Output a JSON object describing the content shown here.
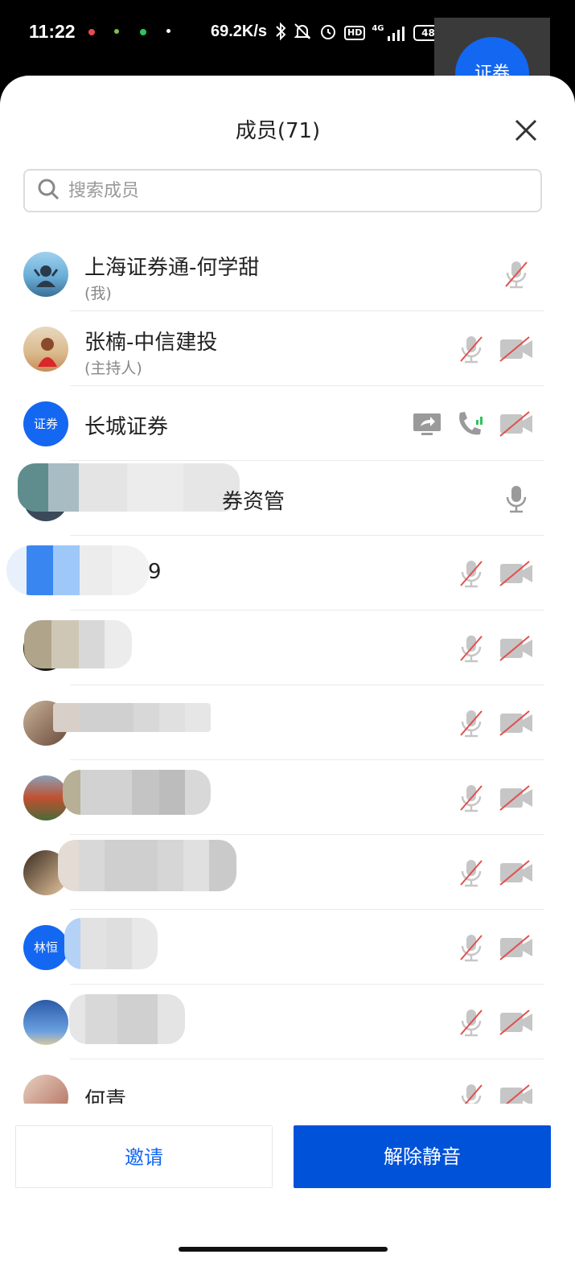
{
  "status_bar": {
    "time": "11:22",
    "speed": "69.2K/s",
    "hd": "HD",
    "network": "4G",
    "battery": "48"
  },
  "floating_button": {
    "label": "证券"
  },
  "panel": {
    "title": "成员(71)",
    "search_placeholder": "搜索成员"
  },
  "members": [
    {
      "name": "上海证券通-何学甜",
      "role": "(我)",
      "avatar_icon": "photo-avatar-icon"
    },
    {
      "name": "张楠-中信建投",
      "role": "(主持人)",
      "avatar_icon": "photo-avatar-icon"
    },
    {
      "name": "长城证券",
      "avatar_text": "证券"
    },
    {
      "name_visible": "券资管"
    },
    {
      "name_visible": "9"
    },
    {
      "name_visible": ""
    },
    {
      "name_visible": ""
    },
    {
      "name_visible": ""
    },
    {
      "name_visible": ""
    },
    {
      "name_visible": "",
      "avatar_text": "林恒"
    },
    {
      "name_visible": ""
    },
    {
      "name": "何青"
    }
  ],
  "actions": {
    "invite": "邀请",
    "unmute": "解除静音"
  },
  "colors": {
    "accent": "#1467f0",
    "primary_button": "#0052d9",
    "muted_slash": "#e05050"
  }
}
